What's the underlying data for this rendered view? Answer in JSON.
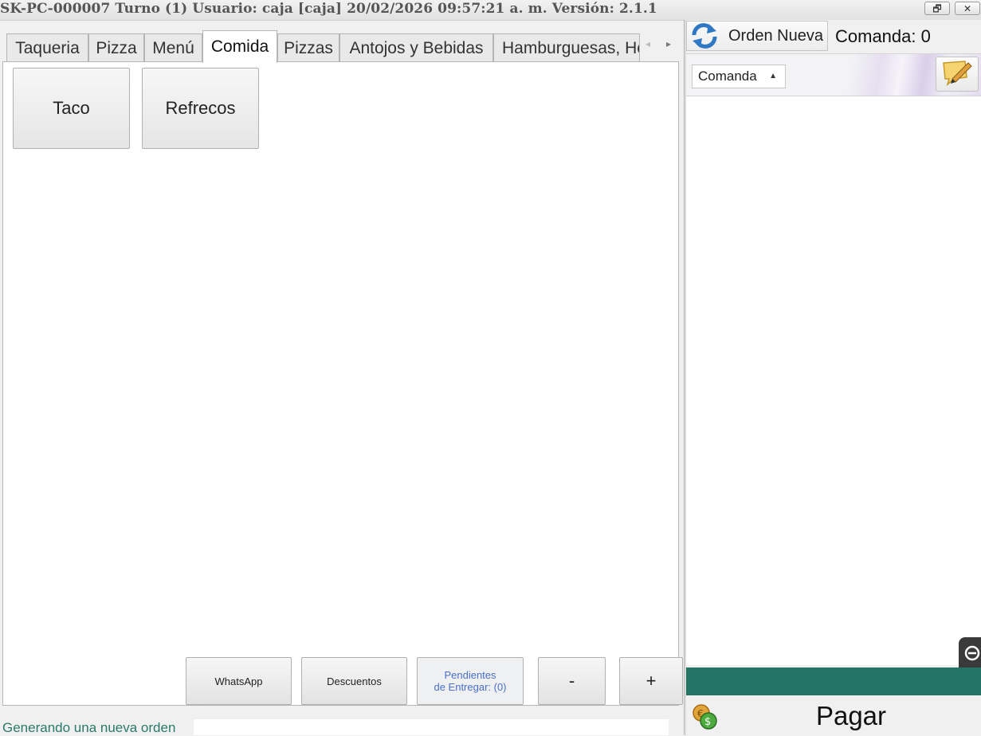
{
  "window": {
    "title": "SK-PC-000007 Turno (1) Usuario: caja [caja] 20/02/2026 09:57:21 a. m. Versión: 2.1.1",
    "restore_glyph": "🗗",
    "close_glyph": "✕"
  },
  "tabs": [
    {
      "label": "Taqueria",
      "active": false
    },
    {
      "label": "Pizza",
      "active": false
    },
    {
      "label": "Menú",
      "active": false
    },
    {
      "label": "Comida",
      "active": true
    },
    {
      "label": "Pizzas",
      "active": false
    },
    {
      "label": "Antojos y Bebidas",
      "active": false
    },
    {
      "label": "Hamburguesas, Hot Dogs",
      "active": false
    }
  ],
  "tab_scroll": {
    "left": "◂",
    "right": "▸"
  },
  "categories": [
    {
      "label": "Taco"
    },
    {
      "label": "Refrecos"
    }
  ],
  "actions": {
    "whatsapp": "WhatsApp",
    "descuentos": "Descuentos",
    "pendientes_line1": "Pendientes",
    "pendientes_line2": "de Entregar: (0)",
    "minus": "-",
    "plus": "+"
  },
  "status": {
    "message": "Generando una nueva orden"
  },
  "order_panel": {
    "new_order_label": "Orden Nueva",
    "comanda_count": "Comanda: 0",
    "view_select": "Comanda",
    "caret": "▲",
    "pay_label": "Pagar"
  },
  "colors": {
    "accent_teal": "#247565",
    "status_text": "#2a7a6a",
    "pending_text": "#4a6fc9"
  }
}
